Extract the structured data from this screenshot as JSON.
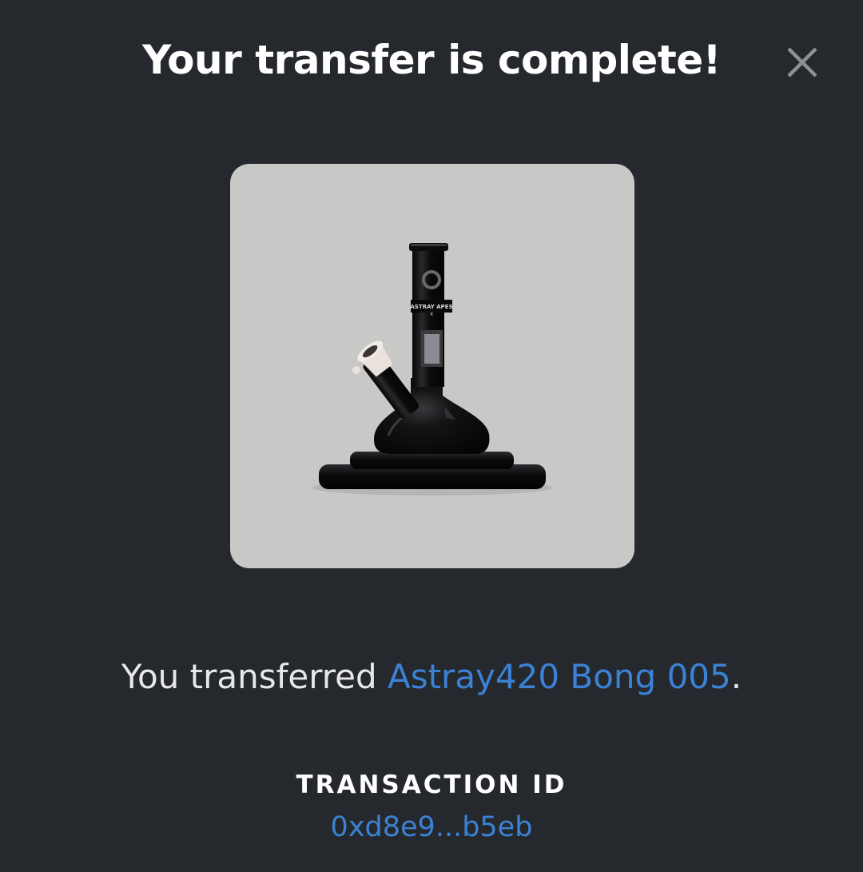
{
  "modal": {
    "title": "Your transfer is complete!",
    "close_icon": "close-icon"
  },
  "nft": {
    "name": "Astray420 Bong 005",
    "logo_text": "ASTRAY APES",
    "card_bg_color": "#c8c8c6"
  },
  "message": {
    "prefix": "You transferred ",
    "item_name": "Astray420 Bong 005",
    "suffix": "."
  },
  "transaction": {
    "label": "TRANSACTION ID",
    "id": "0xd8e9...b5eb"
  },
  "colors": {
    "background": "#25282d",
    "link": "#3b82d4",
    "text": "#ffffff"
  }
}
